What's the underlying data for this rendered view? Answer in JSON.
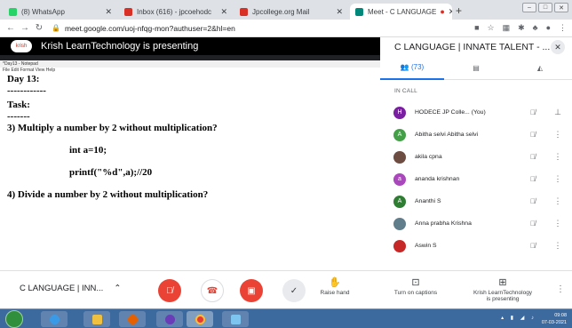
{
  "browser": {
    "tabs": [
      {
        "title": "(8) WhatsApp",
        "color": "#25d366",
        "active": false
      },
      {
        "title": "Inbox (616) - jpcoehodc",
        "color": "#d93025",
        "active": false
      },
      {
        "title": "Jpcollege.org Mail",
        "color": "#d93025",
        "active": false
      },
      {
        "title": "Meet - C LANGUAGE",
        "color": "#00897b",
        "active": true
      }
    ],
    "new_tab": "+",
    "url": "meet.google.com/uoj-nfqg-mon?authuser=2&hl=en"
  },
  "meet": {
    "presenter_banner": "Krish LearnTechnology is presenting",
    "presenter_logo": "krish",
    "notepad": {
      "title": "*Day13 - Notepad",
      "menu": "File  Edit  Format  View  Help",
      "lines": [
        "Day 13:",
        "------------",
        "Task:",
        "-------",
        "3) Multiply a number by 2 without multiplication?",
        "",
        "int a=10;",
        "",
        "printf(\"%d\",a);//20",
        "",
        "4) Divide a number by 2 without multiplication?"
      ]
    },
    "panel": {
      "title": "C LANGUAGE | INNATE TALENT - ...",
      "people_count": "(73)",
      "section_label": "IN CALL",
      "participants": [
        {
          "initial": "H",
          "name": "HODECE JP Colle...  (You)",
          "color": "#7b1fa2",
          "extra": "pin"
        },
        {
          "initial": "A",
          "name": "Abitha selvi Abitha selvi",
          "color": "#43a047",
          "extra": "more"
        },
        {
          "initial": "",
          "name": "akila cpna",
          "color": "#6d4c41",
          "extra": "more"
        },
        {
          "initial": "a",
          "name": "ananda krishnan",
          "color": "#ab47bc",
          "extra": "more"
        },
        {
          "initial": "A",
          "name": "Ananthi S",
          "color": "#2e7d32",
          "extra": "more"
        },
        {
          "initial": "",
          "name": "Anna prabha Krishna",
          "color": "#607d8b",
          "extra": "more"
        },
        {
          "initial": "",
          "name": "Aswin S",
          "color": "#c62828",
          "extra": "more"
        }
      ]
    },
    "controls": {
      "meeting_name": "C LANGUAGE | INN...",
      "raise_hand": "Raise hand",
      "captions": "Turn on captions",
      "presenting_line1": "Krish LearnTechnology",
      "presenting_line2": "is presenting",
      "mic_color": "#ea4335",
      "hangup_color": "#ea4335",
      "camera_color": "#ea4335"
    }
  },
  "taskbar": {
    "time": "09:08",
    "date": "07-03-2021"
  }
}
